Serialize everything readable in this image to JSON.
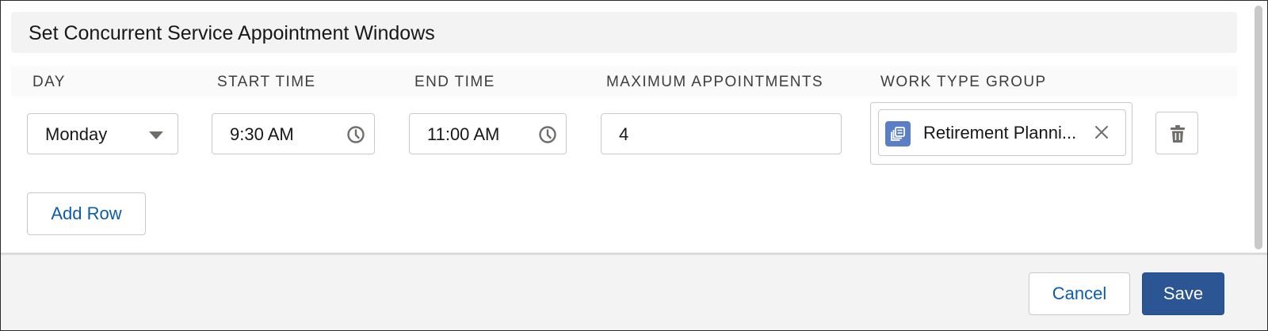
{
  "section": {
    "title": "Set Concurrent Service Appointment Windows"
  },
  "columns": {
    "day": "DAY",
    "start_time": "START TIME",
    "end_time": "END TIME",
    "max_appointments": "MAXIMUM APPOINTMENTS",
    "work_type_group": "WORK TYPE GROUP"
  },
  "row": {
    "day": "Monday",
    "start_time": "9:30 AM",
    "end_time": "11:00 AM",
    "max_appointments": "4",
    "work_type_group": "Retirement Planni..."
  },
  "icons": {
    "day_dropdown": "caret-down-icon",
    "time_picker": "clock-icon",
    "work_type_group": "work-type-group-icon",
    "remove_selection": "close-icon",
    "delete_row": "trash-icon"
  },
  "actions": {
    "add_row": "Add Row"
  },
  "footer": {
    "cancel": "Cancel",
    "save": "Save"
  },
  "colors": {
    "brand": "#2c5594",
    "link": "#0b5cab",
    "work_type_icon": "#5a7fc6"
  }
}
